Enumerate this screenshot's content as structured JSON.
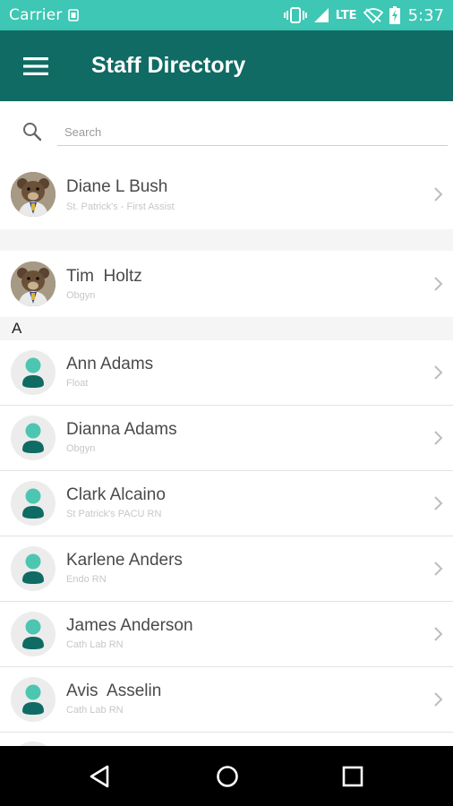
{
  "status_bar": {
    "carrier": "Carrier",
    "network": "LTE",
    "time": "5:37",
    "icons": [
      "sim-icon",
      "vibrate-icon",
      "signal-icon",
      "wifi-off-icon",
      "battery-charging-icon"
    ]
  },
  "app_bar": {
    "title": "Staff Directory",
    "menu_icon": "hamburger-menu-icon"
  },
  "search": {
    "placeholder": "Search",
    "icon": "search-icon"
  },
  "favorites": [
    {
      "name": "Diane L Bush",
      "subtitle": "St. Patrick's - First Assist",
      "avatar": "photo"
    },
    {
      "name": "Tim  Holtz",
      "subtitle": "Obgyn",
      "avatar": "photo"
    }
  ],
  "section_header": "A",
  "contacts": [
    {
      "name": "Ann Adams",
      "subtitle": "Float",
      "avatar": "generic"
    },
    {
      "name": "Dianna Adams",
      "subtitle": "Obgyn",
      "avatar": "generic"
    },
    {
      "name": "Clark Alcaino",
      "subtitle": "St Patrick's PACU RN",
      "avatar": "generic"
    },
    {
      "name": "Karlene Anders",
      "subtitle": "Endo RN",
      "avatar": "generic"
    },
    {
      "name": "James Anderson",
      "subtitle": "Cath Lab RN",
      "avatar": "generic"
    },
    {
      "name": "Avis  Asselin",
      "subtitle": "Cath Lab RN",
      "avatar": "generic"
    }
  ],
  "colors": {
    "status_bar": "#3dc7b4",
    "app_bar": "#0f6b63",
    "avatar_head": "#4cc6b1",
    "avatar_body": "#0f6b63",
    "navigation_bar": "#000000"
  },
  "nav_bar": {
    "icons": [
      "back-icon",
      "home-icon",
      "recents-icon"
    ]
  }
}
